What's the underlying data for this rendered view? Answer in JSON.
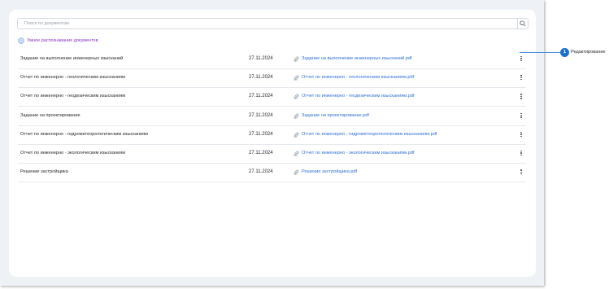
{
  "search": {
    "placeholder": "Поиск по документам"
  },
  "smart_recognition": {
    "label": "Умное распознавание документов"
  },
  "documents": [
    {
      "name": "Задание на выполнение инженерных изысканий",
      "date": "27.11.2024",
      "file": "Задание на выполнение инженерных изысканий.pdf"
    },
    {
      "name": "Отчет по инженерно - геологическим изысканиям",
      "date": "27.11.2024",
      "file": "Отчет по инженерно - геологическим изысканиям.pdf"
    },
    {
      "name": "Отчет по инженерно - геодезическим изысканиям",
      "date": "27.11.2024",
      "file": "Отчет по инженерно - геодезическим изысканиям.pdf"
    },
    {
      "name": "Задание на проектирование",
      "date": "27.11.2024",
      "file": "Задание на проектирование.pdf"
    },
    {
      "name": "Отчет по инженерно - гидрометеорологическим изысканиям",
      "date": "27.11.2024",
      "file": "Отчет по инженерно - гидрометеорологическим изысканиям.pdf"
    },
    {
      "name": "Отчет по инженерно - экологическим изысканиям",
      "date": "27.11.2024",
      "file": "Отчет по инженерно - экологическим изысканиям.pdf"
    },
    {
      "name": "Решение застройщика",
      "date": "27.11.2024",
      "file": "Решение застройщика.pdf"
    }
  ],
  "callout": {
    "number": "1",
    "label": "Редактирование"
  },
  "colors": {
    "link": "#2f6fd6",
    "smart_label": "#8a33c8",
    "callout": "#1e6fc9"
  },
  "icons": {
    "search": "search-icon",
    "attachment": "paperclip-icon",
    "menu": "more-vertical-icon",
    "smart": "circle-icon"
  }
}
